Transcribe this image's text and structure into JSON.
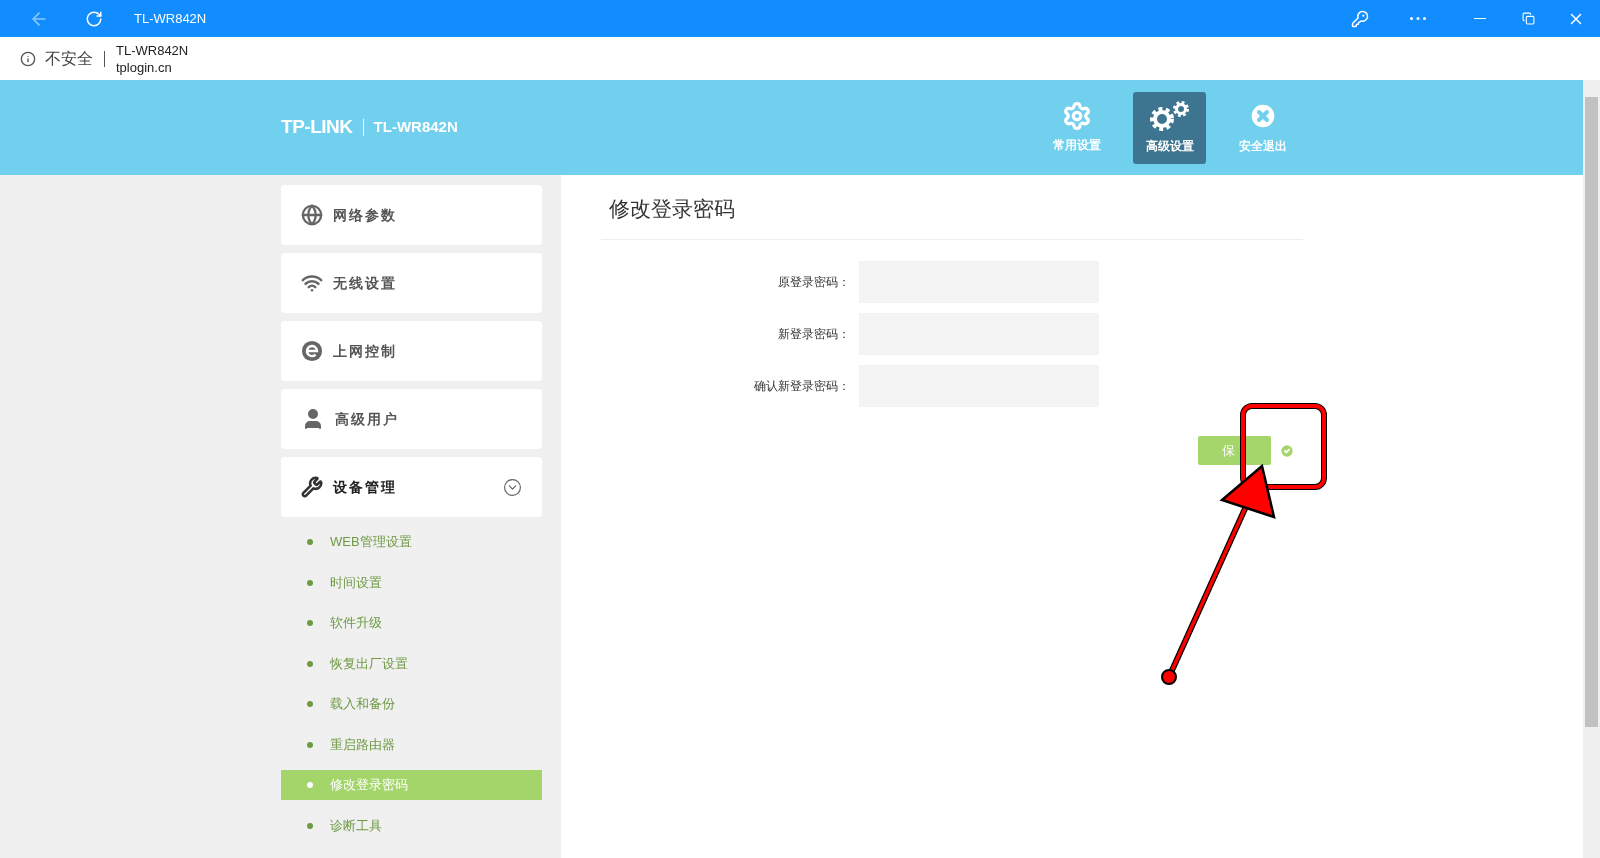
{
  "browser": {
    "title": "TL-WR842N",
    "security": "不安全",
    "page_title": "TL-WR842N",
    "url": "tplogin.cn"
  },
  "header": {
    "logo": "TP-LINK",
    "model": "TL-WR842N",
    "nav": [
      {
        "label": "常用设置",
        "selected": false
      },
      {
        "label": "高级设置",
        "selected": true
      },
      {
        "label": "安全退出",
        "selected": false
      }
    ]
  },
  "sidebar": {
    "items": [
      {
        "label": "网络参数",
        "expanded": false
      },
      {
        "label": "无线设置",
        "expanded": false
      },
      {
        "label": "上网控制",
        "expanded": false
      },
      {
        "label": "高级用户",
        "expanded": false
      },
      {
        "label": "设备管理",
        "expanded": true,
        "children": [
          {
            "label": "WEB管理设置",
            "selected": false
          },
          {
            "label": "时间设置",
            "selected": false
          },
          {
            "label": "软件升级",
            "selected": false
          },
          {
            "label": "恢复出厂设置",
            "selected": false
          },
          {
            "label": "载入和备份",
            "selected": false
          },
          {
            "label": "重启路由器",
            "selected": false
          },
          {
            "label": "修改登录密码",
            "selected": true
          },
          {
            "label": "诊断工具",
            "selected": false
          }
        ]
      }
    ]
  },
  "form": {
    "title": "修改登录密码",
    "fields": [
      {
        "label": "原登录密码："
      },
      {
        "label": "新登录密码："
      },
      {
        "label": "确认新登录密码："
      }
    ],
    "save_button": "保"
  }
}
